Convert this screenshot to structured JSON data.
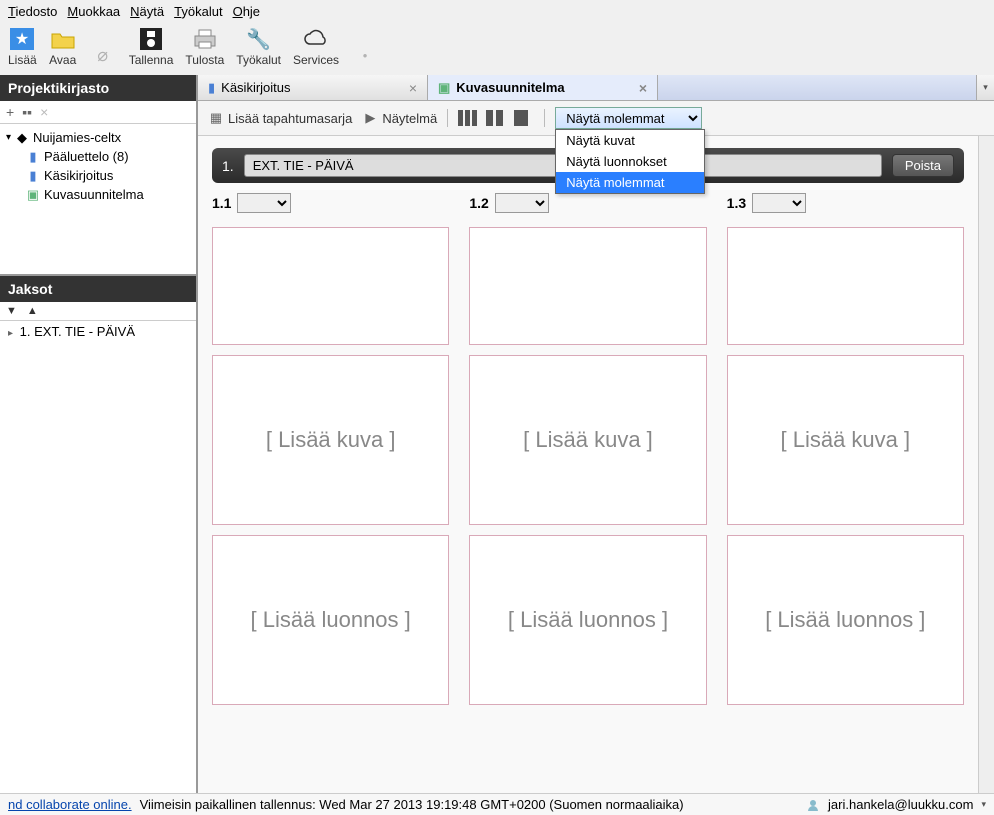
{
  "menu": {
    "items": [
      "Tiedosto",
      "Muokkaa",
      "Näytä",
      "Työkalut",
      "Ohje"
    ]
  },
  "toolbar": {
    "add": "Lisää",
    "open": "Avaa",
    "save": "Tallenna",
    "print": "Tulosta",
    "tools": "Työkalut",
    "services": "Services"
  },
  "sidebar": {
    "library_title": "Projektikirjasto",
    "project_name": "Nuijamies-celtx",
    "items": [
      {
        "label": "Pääluettelo (8)"
      },
      {
        "label": "Käsikirjoitus"
      },
      {
        "label": "Kuvasuunnitelma"
      }
    ],
    "sequences_title": "Jaksot",
    "sequences": [
      "1. EXT. TIE - PÄIVÄ"
    ]
  },
  "tabs": [
    {
      "label": "Käsikirjoitus",
      "active": false
    },
    {
      "label": "Kuvasuunnitelma",
      "active": true
    }
  ],
  "subtoolbar": {
    "add_sequence": "Lisää tapahtumasarja",
    "play": "Näytelmä",
    "view_select_value": "Näytä molemmat",
    "view_options": [
      "Näytä kuvat",
      "Näytä luonnokset",
      "Näytä molemmat"
    ],
    "highlight_index": 2
  },
  "scene": {
    "number": "1.",
    "title": "EXT. TIE - PÄIVÄ",
    "delete_label": "Poista"
  },
  "shots": {
    "labels": [
      "1.1",
      "1.2",
      "1.3"
    ],
    "add_image": "[ Lisää kuva ]",
    "add_draft": "[ Lisää luonnos ]"
  },
  "status": {
    "link": "nd collaborate online.",
    "save_text": "Viimeisin paikallinen tallennus: Wed Mar 27 2013 19:19:48 GMT+0200 (Suomen normaaliaika)",
    "user": "jari.hankela@luukku.com"
  }
}
